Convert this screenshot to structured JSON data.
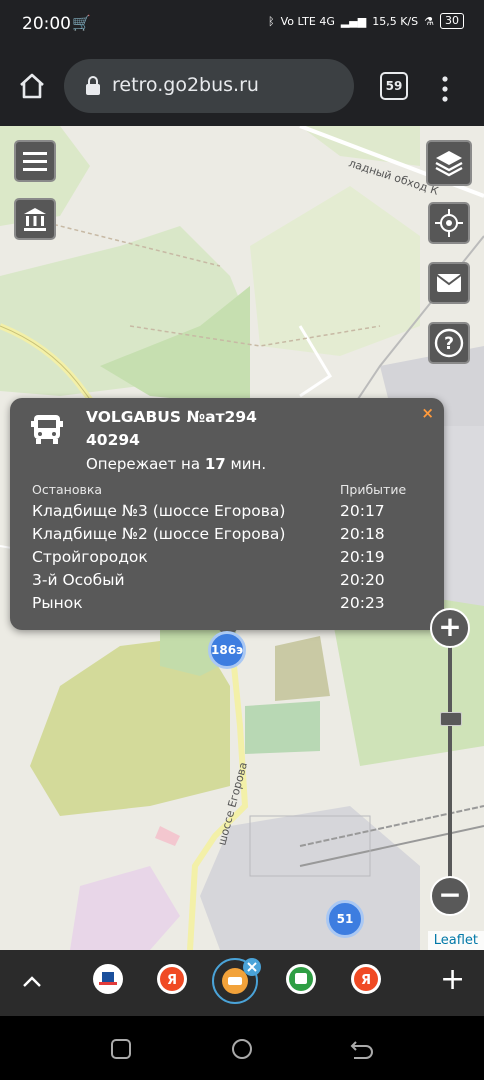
{
  "status_bar": {
    "time": "20:00",
    "signal_text": "Vo LTE 4G",
    "speed": "15,5 K/S",
    "battery": "30"
  },
  "browser": {
    "url": "retro.go2bus.ru",
    "tab_count": "59"
  },
  "map": {
    "road_label": "шоссе Егорова",
    "road_label_top": "ладный обход К",
    "attribution": "Leaflet",
    "markers": [
      {
        "label": "186э"
      },
      {
        "label": "51"
      }
    ]
  },
  "popup": {
    "title": "VOLGABUS №ат294",
    "number": "40294",
    "ahead_prefix": "Опережает на",
    "ahead_value": "17",
    "ahead_suffix": "мин.",
    "close": "×",
    "col_stop": "Остановка",
    "col_arrival": "Прибытие",
    "rows": [
      {
        "stop": "Кладбище №3 (шоссе Егорова)",
        "arrival": "20:17"
      },
      {
        "stop": "Кладбище №2 (шоссе Егорова)",
        "arrival": "20:18"
      },
      {
        "stop": "Стройгородок",
        "arrival": "20:19"
      },
      {
        "stop": "3-й Особый",
        "arrival": "20:20"
      },
      {
        "stop": "Рынок",
        "arrival": "20:23"
      }
    ]
  },
  "zoom": {
    "plus": "+",
    "minus": "−"
  },
  "bottom_bar": {
    "add": "+"
  },
  "icons": [
    "menu-icon",
    "museum-icon",
    "layers-icon",
    "locate-icon",
    "mail-icon",
    "help-icon",
    "bus-icon"
  ]
}
